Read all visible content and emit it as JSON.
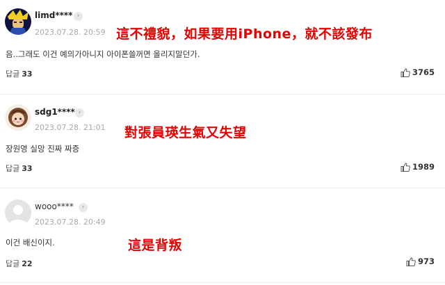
{
  "comments": [
    {
      "username": "limd****",
      "date": "2023.07.28. 20:59",
      "text": "음..그래도 이건 예의가아니지 아이폰쓸꺼면 올리지말던가.",
      "reply_label": "답글",
      "reply_count": "33",
      "likes": "3765",
      "annotation": "這不禮貌，如果要用iPhone，就不該發布"
    },
    {
      "username": "sdg1****",
      "date": "2023.07.28. 21:01",
      "text": "장원영 실망 진짜 짜증",
      "reply_label": "답글",
      "reply_count": "33",
      "likes": "1989",
      "annotation": "對張員瑛生氣又失望"
    },
    {
      "username": "wooo****",
      "date": "2023.07.28. 20:49",
      "text": "이건 배신이지.",
      "reply_label": "답글",
      "reply_count": "22",
      "likes": "973",
      "annotation": "這是背叛"
    }
  ],
  "icons": {
    "chevron": "chevron-right-icon",
    "like": "thumbs-up-icon"
  },
  "colors": {
    "annotation": "#e60000",
    "date": "#a9a9a9"
  }
}
